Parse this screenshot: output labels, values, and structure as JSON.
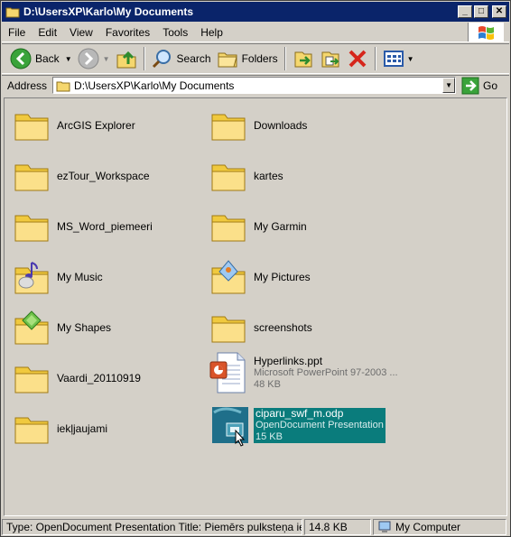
{
  "window": {
    "title": "D:\\UsersXP\\Karlo\\My Documents"
  },
  "menu": [
    {
      "label": "File"
    },
    {
      "label": "Edit"
    },
    {
      "label": "View"
    },
    {
      "label": "Favorites"
    },
    {
      "label": "Tools"
    },
    {
      "label": "Help"
    }
  ],
  "toolbar": {
    "back_label": "Back",
    "search_label": "Search",
    "folders_label": "Folders"
  },
  "address": {
    "label": "Address",
    "value": "D:\\UsersXP\\Karlo\\My Documents",
    "go_label": "Go"
  },
  "items": [
    {
      "name": "ArcGIS Explorer"
    },
    {
      "name": "Downloads"
    },
    {
      "name": "ezTour_Workspace"
    },
    {
      "name": "kartes"
    },
    {
      "name": "MS_Word_piemeeri"
    },
    {
      "name": "My Garmin"
    },
    {
      "name": "My Music"
    },
    {
      "name": "My Pictures"
    },
    {
      "name": "My Shapes"
    },
    {
      "name": "screenshots"
    },
    {
      "name": "Vaardi_20110919"
    },
    {
      "name": "Hyperlinks.ppt",
      "type": "Microsoft PowerPoint 97-2003 ...",
      "size": "48 KB"
    },
    {
      "name": "iekļjaujami"
    },
    {
      "name": "ciparu_swf_m.odp",
      "type": "OpenDocument Presentation",
      "size": "15 KB"
    }
  ],
  "status": {
    "info": "Type: OpenDocument Presentation Title: Piemērs pulksteņa iekļaušan",
    "size": "14.8 KB",
    "zone": "My Computer"
  }
}
